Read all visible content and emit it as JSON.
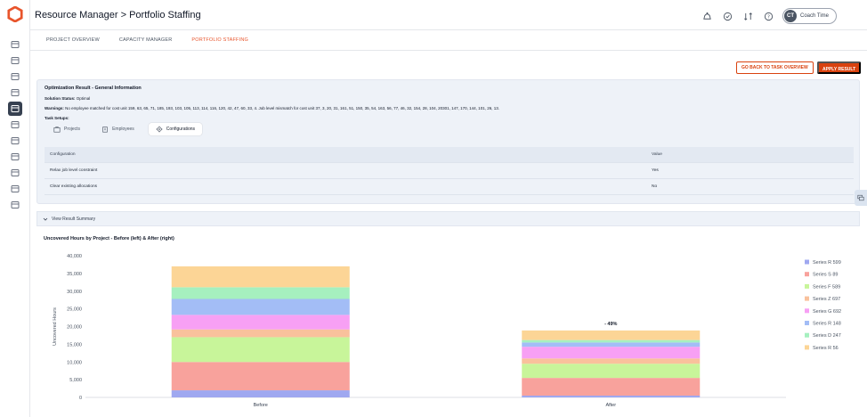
{
  "breadcrumb": "Resource Manager > Portfolio Staffing",
  "rail_icons": [
    "dashboard-icon",
    "tools-icon",
    "team-icon",
    "org-icon",
    "portfolio-icon",
    "calendar-icon",
    "cards-icon",
    "pipeline-icon",
    "database-icon",
    "analytics-icon",
    "chat-icon"
  ],
  "user": {
    "initials": "CT",
    "name": "Coach Time"
  },
  "tabs": [
    {
      "label": "PROJECT OVERVIEW",
      "active": false
    },
    {
      "label": "CAPACITY MANAGER",
      "active": false
    },
    {
      "label": "PORTFOLIO STAFFING",
      "active": true
    }
  ],
  "actions": {
    "back_label": "GO BACK TO TASK OVERVIEW",
    "apply_label": "APPLY RESULT"
  },
  "result": {
    "title": "Optimization Result - General Information",
    "status_label": "Solution Status:",
    "status_value": "Optimal",
    "warnings_label": "Warnings:",
    "warnings_value": "No employee matched for cost unit 159, 63, 65, 71, 185, 193, 103, 105, 113, 114, 116, 120, 42, 47, 60, 33, 4. Job level mismatch for cost unit 37, 3, 20, 31, 161, 51, 150, 35, 54, 163, 56, 77, 46, 32, 154, 28, 104, 20301, 147, 170, 144, 101, 26, 13.",
    "setups_label": "Task Setups:",
    "setup_tabs": [
      {
        "label": "Projects",
        "icon": "briefcase-icon",
        "active": false
      },
      {
        "label": "Employees",
        "icon": "building-icon",
        "active": false
      },
      {
        "label": "Configurations",
        "icon": "gear-icon",
        "active": true
      }
    ],
    "table": {
      "headers": [
        "Configuration",
        "Value"
      ],
      "rows": [
        [
          "Relax job level constraint",
          "Yes"
        ],
        [
          "Clear existing allocations",
          "No"
        ]
      ]
    }
  },
  "summary_toggle": "View Result Summary",
  "chart_title": "Uncovered Hours by Project - Before (left) & After (right)",
  "colors": {
    "accent": "#d9420f",
    "active_tab": "#e8542b"
  },
  "chart_data": {
    "type": "bar",
    "stacked": true,
    "categories": [
      "Before",
      "After"
    ],
    "ylabel": "Uncovered Hours",
    "ylim": [
      0,
      40000
    ],
    "yticks": [
      0,
      5000,
      10000,
      15000,
      20000,
      25000,
      30000,
      35000,
      40000
    ],
    "ytick_labels": [
      "0",
      "5,000",
      "10,000",
      "15,000",
      "20,000",
      "25,000",
      "30,000",
      "35,000",
      "40,000"
    ],
    "grid": false,
    "legend_position": "right",
    "annotations": [
      {
        "category": "After",
        "text": "- 49%"
      }
    ],
    "series": [
      {
        "name": "Series R 599",
        "color": "#9fa8f0",
        "values": [
          2000,
          500
        ]
      },
      {
        "name": "Series S 89",
        "color": "#f8a29c",
        "values": [
          8000,
          5000
        ]
      },
      {
        "name": "Series F 589",
        "color": "#c8f59a",
        "values": [
          7000,
          4000
        ]
      },
      {
        "name": "Series Z 697",
        "color": "#f9c19c",
        "values": [
          2200,
          1500
        ]
      },
      {
        "name": "Series G 692",
        "color": "#f7a0f4",
        "values": [
          4100,
          3300
        ]
      },
      {
        "name": "Series R 148",
        "color": "#a3bdf6",
        "values": [
          4500,
          1200
        ]
      },
      {
        "name": "Series D 247",
        "color": "#a6f0bf",
        "values": [
          3300,
          700
        ]
      },
      {
        "name": "Series R 56",
        "color": "#fcd596",
        "values": [
          5900,
          2700
        ]
      }
    ]
  }
}
